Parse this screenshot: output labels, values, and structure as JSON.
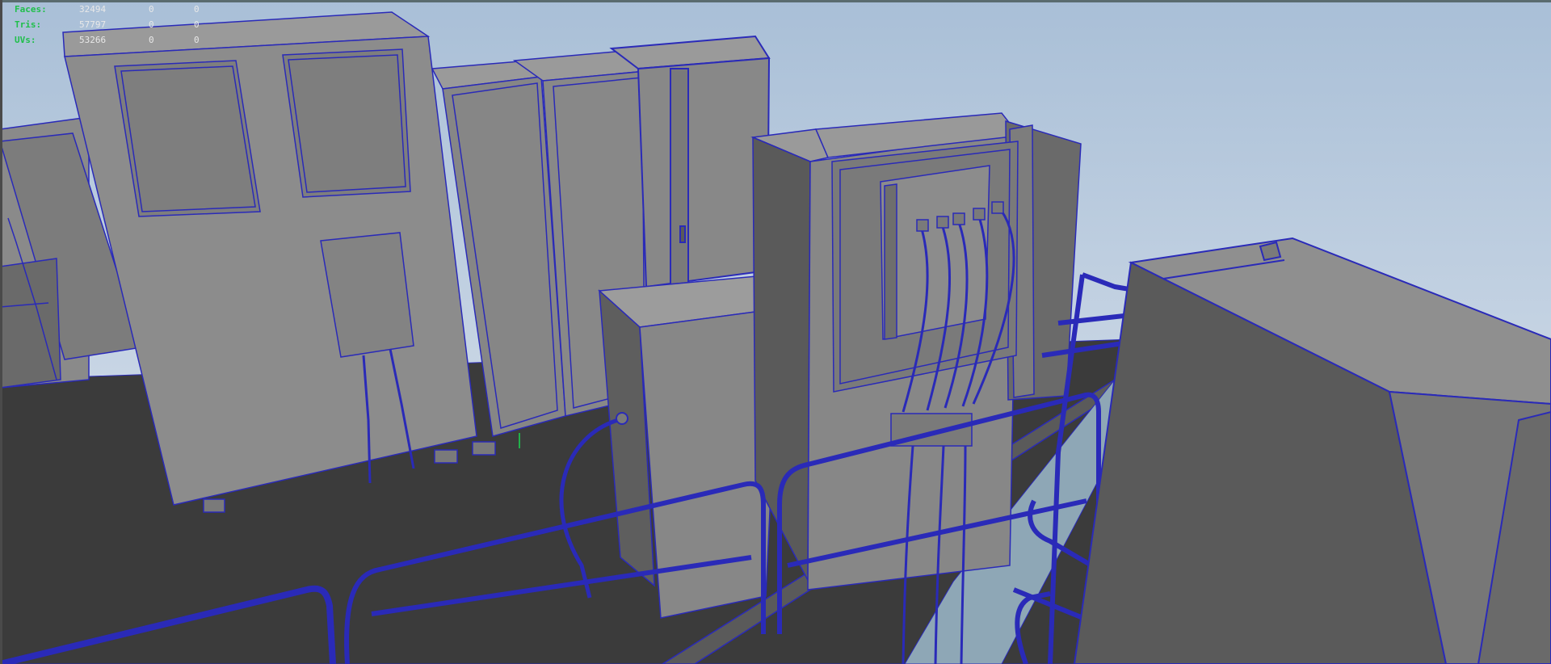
{
  "hud": {
    "rows": [
      {
        "label": "Faces:",
        "value": "32494",
        "c1": "0",
        "c2": "0"
      },
      {
        "label": "Tris:",
        "value": "57797",
        "c1": "0",
        "c2": "0"
      },
      {
        "label": "UVs:",
        "value": "53266",
        "c1": "0",
        "c2": "0"
      }
    ]
  },
  "colors": {
    "sky_top": "#a7bdd6",
    "sky_bottom": "#dde4ec",
    "floor": "#3a3a3a",
    "face_light": "#8a8a8a",
    "face_mid": "#6e6e6e",
    "face_dark": "#4e4e4e",
    "wire": "#2a2ab8"
  }
}
